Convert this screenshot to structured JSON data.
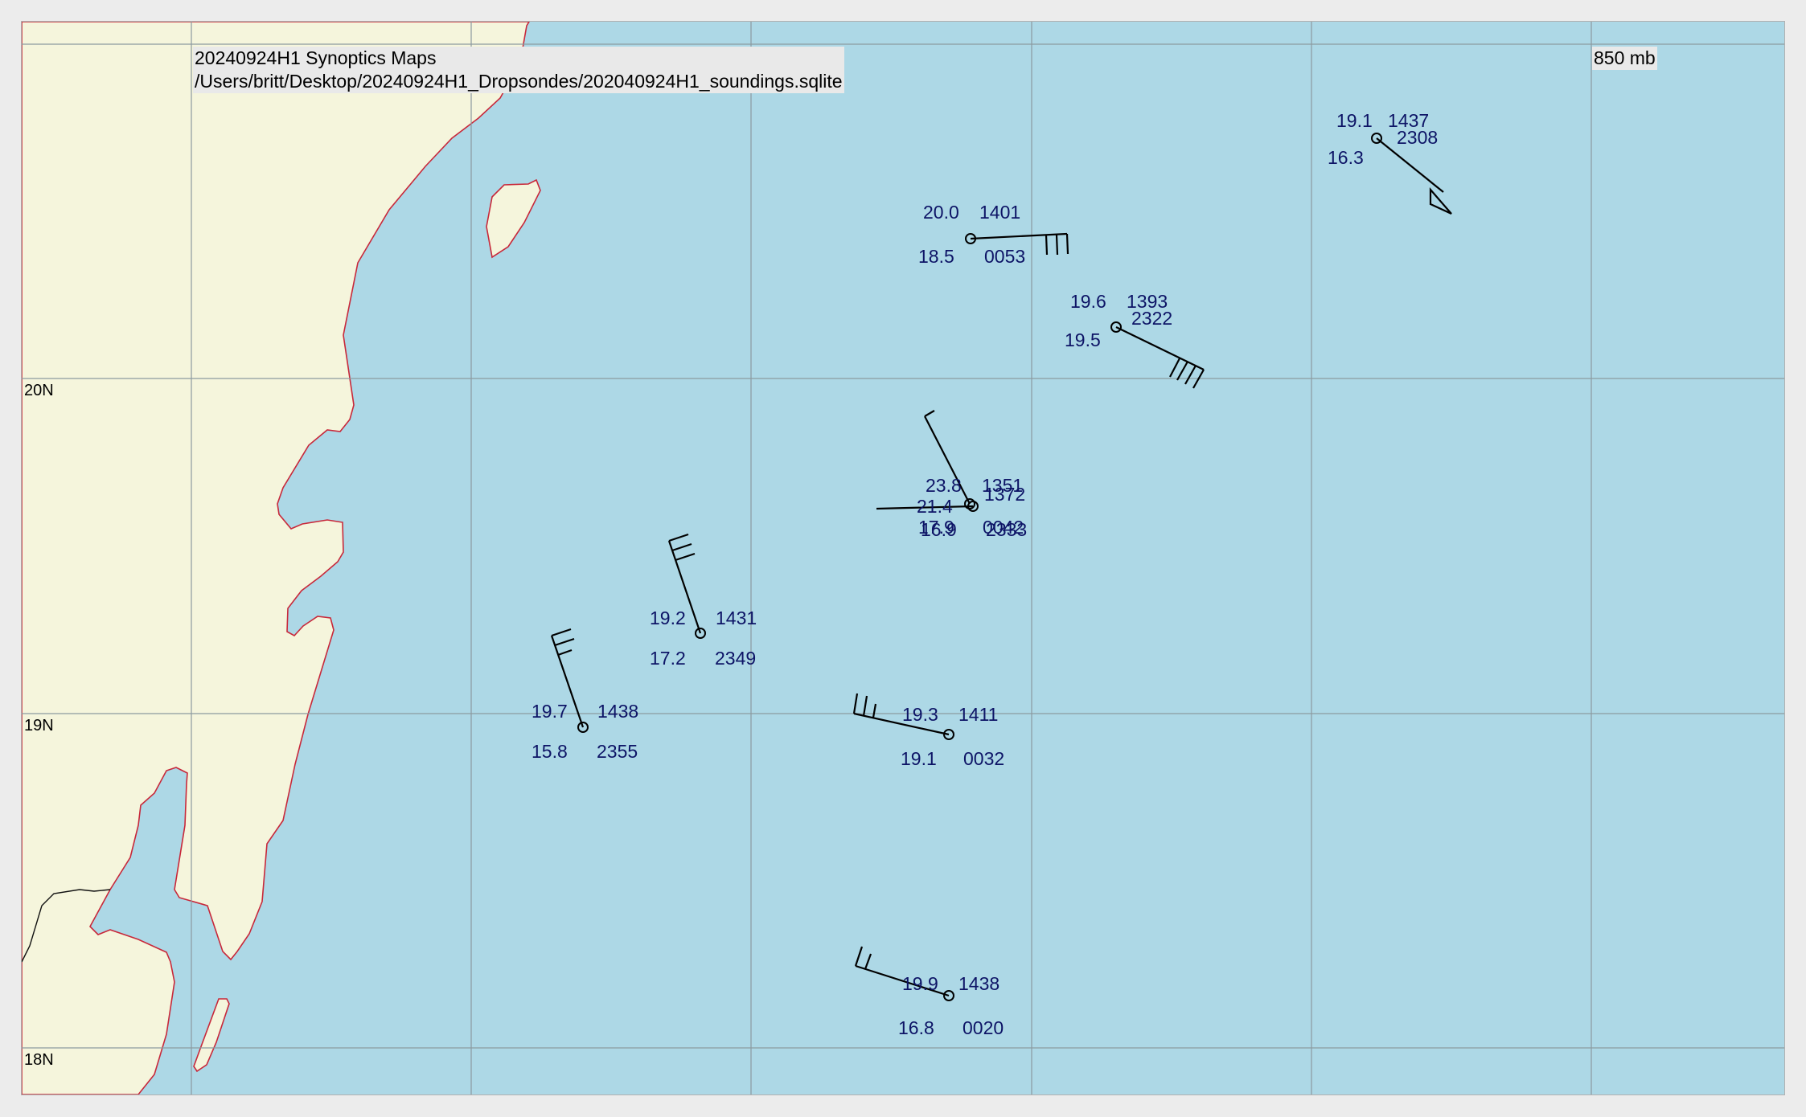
{
  "header": {
    "title": "20240924H1 Synoptics Maps",
    "source_path": "/Users/britt/Desktop/20240924H1_Dropsondes/202040924H1_soundings.sqlite",
    "level": "850 mb"
  },
  "map": {
    "colors": {
      "ocean": "#add8e6",
      "land": "#f5f5dc",
      "coastline": "#c8283a",
      "station_text": "#0d1466"
    },
    "lat_labels": [
      "20N",
      "19N",
      "18N"
    ]
  },
  "stations": [
    {
      "temp": "19.1",
      "dewpoint": "16.3",
      "height": "1437",
      "time": "2308"
    },
    {
      "temp": "20.0",
      "dewpoint": "18.5",
      "height": "1401",
      "time": "0053"
    },
    {
      "temp": "19.6",
      "dewpoint": "19.5",
      "height": "1393",
      "time": "2322"
    },
    {
      "temp": "23.8",
      "dewpoint": "17.9",
      "height": "1351",
      "time": "0042"
    },
    {
      "temp": "21.4",
      "dewpoint": "16.9",
      "height": "1372",
      "time": "2333"
    },
    {
      "temp": "19.2",
      "dewpoint": "17.2",
      "height": "1431",
      "time": "2349"
    },
    {
      "temp": "19.7",
      "dewpoint": "15.8",
      "height": "1438",
      "time": "2355"
    },
    {
      "temp": "19.3",
      "dewpoint": "19.1",
      "height": "1411",
      "time": "0032"
    },
    {
      "temp": "19.9",
      "dewpoint": "16.8",
      "height": "1438",
      "time": "0020"
    }
  ]
}
